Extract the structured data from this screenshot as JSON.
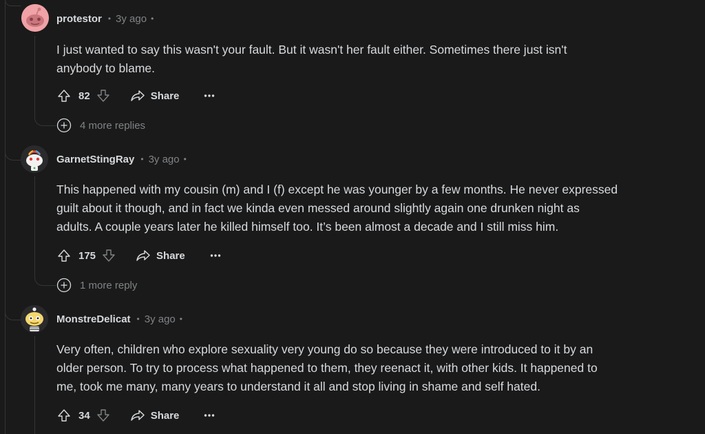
{
  "comments": [
    {
      "username": "protestor",
      "time": "3y ago",
      "body_lines": [
        "I just wanted to say this wasn't your fault. But it wasn't her fault either. Sometimes there just isn't",
        "anybody to blame."
      ],
      "votes": "82",
      "share_label": "Share",
      "replies_label": "4 more replies"
    },
    {
      "username": "GarnetStingRay",
      "time": "3y ago",
      "body_lines": [
        "This happened with my cousin (m) and I (f) except he was younger by a few months. He never expressed",
        "guilt about it though, and in fact we kinda even messed around slightly again one drunken night as",
        "adults. A couple years later he killed himself too. It’s been almost a decade and I still miss him."
      ],
      "votes": "175",
      "share_label": "Share",
      "replies_label": "1 more reply"
    },
    {
      "username": "MonstreDelicat",
      "time": "3y ago",
      "body_lines": [
        "Very often, children who explore sexuality very young do so because they were introduced to it by an",
        "older person. To try to process what happened to them, they reenact it, with other kids. It happened to",
        "me, took me many, many years to understand it all and stop living in shame and self hated."
      ],
      "votes": "34",
      "share_label": "Share"
    }
  ],
  "icons": {
    "upvote": "upvote-icon",
    "downvote": "downvote-icon",
    "share": "share-icon",
    "more": "ellipsis-icon",
    "expand": "plus-circle-icon"
  },
  "colors": {
    "background": "#1a1a1b",
    "text": "#d7dadc",
    "muted": "#818384",
    "thread_line": "#343536"
  }
}
